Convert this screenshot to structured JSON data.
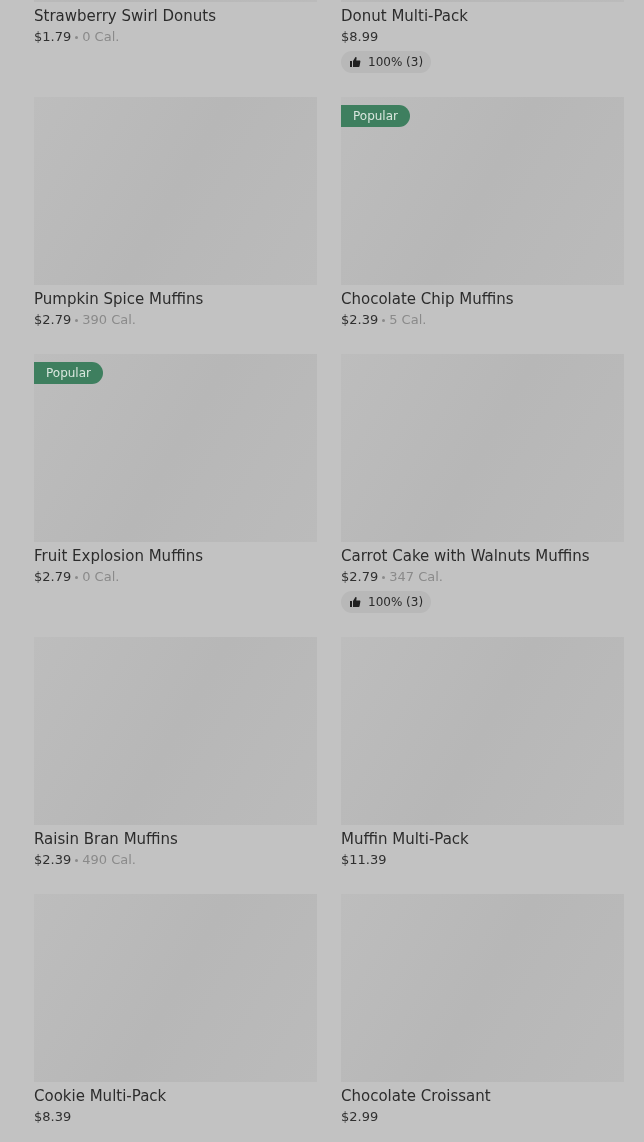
{
  "rows": [
    {
      "items": [
        {
          "name": "Strawberry Swirl Donuts",
          "price": "$1.79",
          "calories": "0 Cal."
        },
        {
          "name": "Donut Multi-Pack",
          "price": "$8.99",
          "rating": "100% (3)"
        }
      ]
    },
    {
      "items": [
        {
          "name": "Pumpkin Spice Muffins",
          "price": "$2.79",
          "calories": "390 Cal."
        },
        {
          "name": "Chocolate Chip Muffins",
          "price": "$2.39",
          "calories": "5 Cal.",
          "badge": "Popular"
        }
      ]
    },
    {
      "items": [
        {
          "name": "Fruit Explosion Muffins",
          "price": "$2.79",
          "calories": "0 Cal.",
          "badge": "Popular"
        },
        {
          "name": "Carrot Cake with Walnuts Muffins",
          "price": "$2.79",
          "calories": "347 Cal.",
          "rating": "100% (3)"
        }
      ]
    },
    {
      "items": [
        {
          "name": "Raisin Bran Muffins",
          "price": "$2.39",
          "calories": "490 Cal."
        },
        {
          "name": "Muffin Multi-Pack",
          "price": "$11.39"
        }
      ]
    },
    {
      "items": [
        {
          "name": "Cookie Multi-Pack",
          "price": "$8.39"
        },
        {
          "name": "Chocolate Croissant",
          "price": "$2.99"
        }
      ]
    }
  ]
}
